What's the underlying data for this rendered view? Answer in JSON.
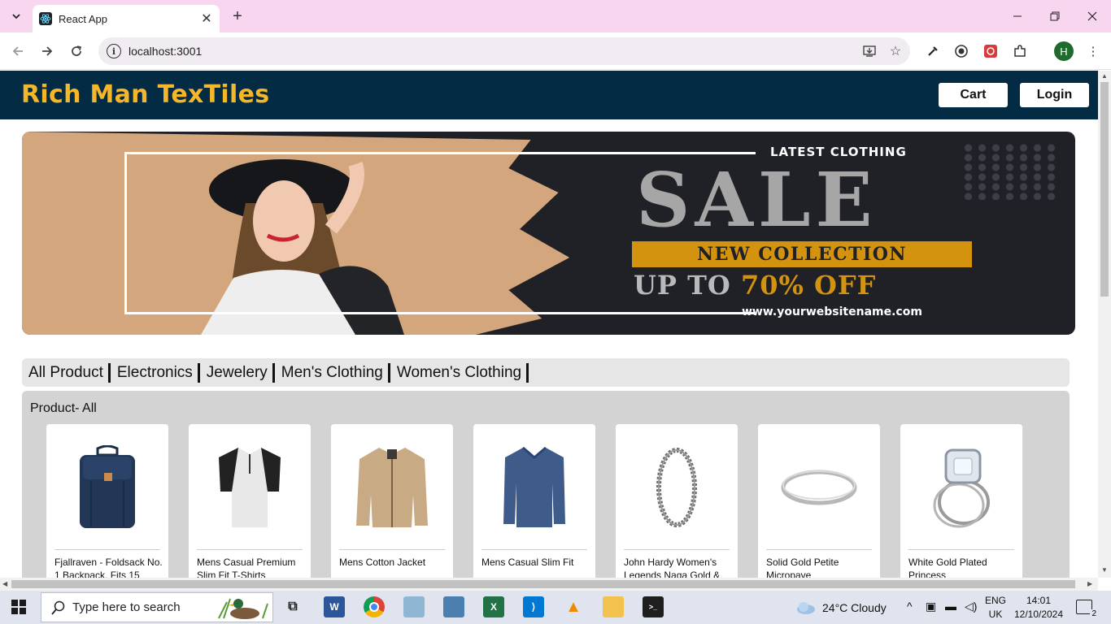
{
  "browser": {
    "tab_title": "React App",
    "url": "localhost:3001",
    "profile_initial": "H"
  },
  "site": {
    "brand": "Rich Man TexTiles",
    "cart_label": "Cart",
    "login_label": "Login"
  },
  "banner": {
    "latest": "LATEST CLOTHING",
    "sale": "SALE",
    "new_collection": "NEW COLLECTION",
    "up_to": "UP TO ",
    "off": "70% OFF",
    "website": "www.yourwebsitename.com"
  },
  "categories": [
    "All Product",
    "Electronics",
    "Jewelery",
    "Men's Clothing",
    "Women's Clothing"
  ],
  "products_panel": {
    "title": "Product- All",
    "products": [
      {
        "title": "Fjallraven - Foldsack No. 1 Backpack, Fits 15",
        "icon": "backpack-icon"
      },
      {
        "title": "Mens Casual Premium Slim Fit T-Shirts",
        "icon": "tshirt-icon"
      },
      {
        "title": "Mens Cotton Jacket",
        "icon": "jacket-icon"
      },
      {
        "title": "Mens Casual Slim Fit",
        "icon": "sweater-icon"
      },
      {
        "title": "John Hardy Women's Legends Naga Gold &",
        "icon": "bracelet-icon"
      },
      {
        "title": "Solid Gold Petite Micropave",
        "icon": "ring-icon"
      },
      {
        "title": "White Gold Plated Princess",
        "icon": "ring-set-icon"
      }
    ]
  },
  "taskbar": {
    "search_placeholder": "Type here to search",
    "weather": "24°C  Cloudy",
    "lang_top": "ENG",
    "lang_bottom": "UK",
    "time": "14:01",
    "date": "12/10/2024",
    "notifications": "2"
  },
  "colors": {
    "header_bg": "#032b44",
    "brand": "#f5b62a",
    "tab_strip": "#f8d6ef",
    "panel": "#d3d3d3",
    "accent_gold": "#d4930f"
  }
}
